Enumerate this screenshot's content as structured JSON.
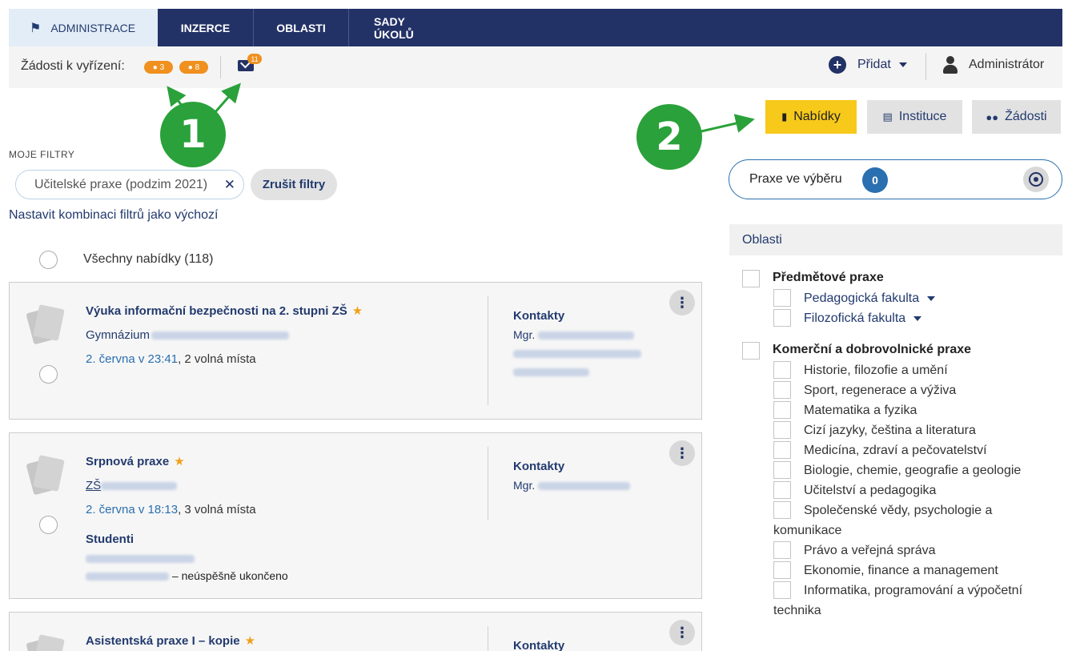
{
  "nav": {
    "tabs": [
      {
        "label": "ADMINISTRACE",
        "active": true
      },
      {
        "label": "INZERCE"
      },
      {
        "label": "OBLASTI"
      },
      {
        "label": "SADY ÚKOLŮ"
      }
    ]
  },
  "subbar": {
    "pending_label": "Žádosti k vyřízení:",
    "pill_a": "3",
    "pill_b": "8",
    "mail_badge": "11",
    "add_label": "Přidat",
    "user_label": "Administrátor"
  },
  "actions": {
    "nabidky": "Nabídky",
    "instituce": "Instituce",
    "zadosti": "Žádosti"
  },
  "annotations": {
    "one": "1",
    "two": "2"
  },
  "filters": {
    "heading": "MOJE FILTRY",
    "active_filter": "Učitelské praxe (podzim 2021)",
    "clear_label": "Zrušit filtry",
    "set_default_link": "Nastavit kombinaci filtrů jako výchozí",
    "all_offers": "Všechny nabídky (118)"
  },
  "offers": [
    {
      "title": "Výuka informační bezpečnosti na 2. stupni ZŠ",
      "institution": "Gymnázium",
      "date": "2. června v 23:41",
      "places": ", 2 volná místa",
      "contacts_heading": "Kontakty",
      "contacts": [
        "Mgr."
      ]
    },
    {
      "title": "Srpnová praxe",
      "institution": "ZŠ",
      "date": "2. června v 18:13",
      "places": ", 3 volná místa",
      "contacts_heading": "Kontakty",
      "contacts": [
        "Mgr."
      ],
      "students_heading": "Studenti",
      "student_status": " – neúspěšně ukončeno"
    },
    {
      "title": "Asistentská praxe I – kopie",
      "contacts_heading": "Kontakty"
    }
  ],
  "selection": {
    "label": "Praxe ve výběru",
    "count": "0"
  },
  "areas": {
    "heading": "Oblasti",
    "group1": "Předmětové praxe",
    "group1_items": [
      "Pedagogická fakulta",
      "Filozofická fakulta"
    ],
    "group2": "Komerční a dobrovolnické praxe",
    "group2_items": [
      "Historie, filozofie a umění",
      "Sport, regenerace a výživa",
      "Matematika a fyzika",
      "Cizí jazyky, čeština a literatura",
      "Medicína, zdraví a pečovatelství",
      "Biologie, chemie, geografie a geologie",
      "Učitelství a pedagogika",
      "Společenské vědy, psychologie a",
      "komunikace",
      "Právo a veřejná správa",
      "Ekonomie, finance a management",
      "Informatika, programování a výpočetní",
      "technika"
    ]
  },
  "colors": {
    "nav": "#233266",
    "accent_orange": "#f0901e",
    "annotation_green": "#2aa13a",
    "highlight_yellow": "#f7c91b"
  }
}
